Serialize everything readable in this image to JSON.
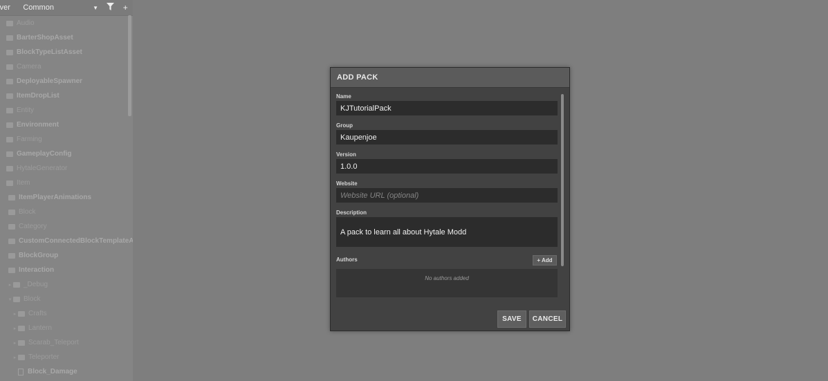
{
  "sidebar": {
    "header": {
      "server_label": "rver",
      "dropdown_value": "Common"
    },
    "tree": [
      {
        "label": "Audio",
        "indent": 0,
        "kind": "folder",
        "bold": false
      },
      {
        "label": "BarterShopAsset",
        "indent": 0,
        "kind": "folder",
        "bold": true
      },
      {
        "label": "BlockTypeListAsset",
        "indent": 0,
        "kind": "folder",
        "bold": true
      },
      {
        "label": "Camera",
        "indent": 0,
        "kind": "folder",
        "bold": false
      },
      {
        "label": "DeployableSpawner",
        "indent": 0,
        "kind": "folder",
        "bold": true
      },
      {
        "label": "ItemDropList",
        "indent": 0,
        "kind": "folder",
        "bold": true
      },
      {
        "label": "Entity",
        "indent": 0,
        "kind": "folder",
        "bold": false
      },
      {
        "label": "Environment",
        "indent": 0,
        "kind": "folder",
        "bold": true
      },
      {
        "label": "Farming",
        "indent": 0,
        "kind": "folder",
        "bold": false
      },
      {
        "label": "GameplayConfig",
        "indent": 0,
        "kind": "folder",
        "bold": true
      },
      {
        "label": "HytaleGenerator",
        "indent": 0,
        "kind": "folder",
        "bold": false
      },
      {
        "label": "Item",
        "indent": 0,
        "kind": "folder",
        "bold": false
      },
      {
        "label": "ItemPlayerAnimations",
        "indent": 1,
        "kind": "folder",
        "bold": true
      },
      {
        "label": "Block",
        "indent": 1,
        "kind": "folder",
        "bold": false
      },
      {
        "label": "Category",
        "indent": 1,
        "kind": "folder",
        "bold": false
      },
      {
        "label": "CustomConnectedBlockTemplateAsset",
        "indent": 1,
        "kind": "folder",
        "bold": true
      },
      {
        "label": "BlockGroup",
        "indent": 1,
        "kind": "folder",
        "bold": true
      },
      {
        "label": "Interaction",
        "indent": 1,
        "kind": "folder",
        "bold": true
      },
      {
        "label": "_Debug",
        "indent": 2,
        "kind": "folder",
        "bold": false,
        "expander": "▸"
      },
      {
        "label": "Block",
        "indent": 2,
        "kind": "folder",
        "bold": false,
        "expander": "▾"
      },
      {
        "label": "Crafts",
        "indent": 3,
        "kind": "folder",
        "bold": false,
        "expander": "▸"
      },
      {
        "label": "Lantern",
        "indent": 3,
        "kind": "folder",
        "bold": false,
        "expander": "▸"
      },
      {
        "label": "Scarab_Teleport",
        "indent": 3,
        "kind": "folder",
        "bold": false,
        "expander": "▸"
      },
      {
        "label": "Teleporter",
        "indent": 3,
        "kind": "folder",
        "bold": false,
        "expander": "▸"
      },
      {
        "label": "Block_Damage",
        "indent": 3,
        "kind": "file",
        "bold": true
      }
    ]
  },
  "modal": {
    "title": "ADD PACK",
    "fields": {
      "name": {
        "label": "Name",
        "value": "KJTutorialPack"
      },
      "group": {
        "label": "Group",
        "value": "Kaupenjoe"
      },
      "version": {
        "label": "Version",
        "value": "1.0.0"
      },
      "website": {
        "label": "Website",
        "value": "",
        "placeholder": "Website URL (optional)"
      },
      "description": {
        "label": "Description",
        "value": "A pack to learn all about Hytale Modd"
      }
    },
    "authors": {
      "label": "Authors",
      "add_label": "+ Add",
      "empty_text": "No authors added"
    },
    "buttons": {
      "save": "SAVE",
      "cancel": "CANCEL"
    }
  }
}
